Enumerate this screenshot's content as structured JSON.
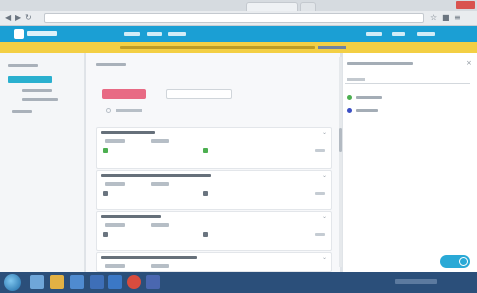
{
  "window": {
    "title": ""
  },
  "browser": {
    "address": "",
    "tabs": [
      {
        "label": ""
      },
      {
        "label": ""
      }
    ]
  },
  "app": {
    "name": "",
    "nav": [
      {
        "label": ""
      },
      {
        "label": ""
      },
      {
        "label": ""
      }
    ],
    "account": [
      {
        "label": ""
      },
      {
        "label": ""
      },
      {
        "label": ""
      }
    ]
  },
  "banner": {
    "text": "",
    "link": ""
  },
  "sidebar": {
    "items": [
      {
        "label": ""
      },
      {
        "label": ""
      },
      {
        "label": ""
      },
      {
        "label": ""
      },
      {
        "label": ""
      }
    ]
  },
  "toolbar": {
    "add_label": "",
    "search_placeholder": "",
    "filter_label": ""
  },
  "cards": [
    {
      "title": "",
      "chips": [
        "",
        ""
      ],
      "footer": "",
      "accent": "#4caf50"
    },
    {
      "title": "",
      "chips": [
        "",
        ""
      ],
      "footer": "",
      "accent": "#6b7580"
    },
    {
      "title": "",
      "chips": [
        "",
        ""
      ],
      "footer": "",
      "accent": "#6b7580"
    },
    {
      "title": "",
      "chips": [
        "",
        ""
      ],
      "footer": "",
      "accent": "#6b7580"
    }
  ],
  "right_panel": {
    "title": "",
    "input_placeholder": "",
    "options": [
      {
        "label": "",
        "color": "#4caf50"
      },
      {
        "label": "",
        "color": "#3b4fc4"
      }
    ]
  },
  "chat_button": {
    "label": ""
  },
  "taskbar": {
    "time": "",
    "date": ""
  },
  "colors": {
    "header": "#1b9fd4",
    "banner": "#f3cf44",
    "primary_button": "#e86a84",
    "sidebar_active": "#2ab0cf",
    "taskbar": "#2b4f7a"
  }
}
